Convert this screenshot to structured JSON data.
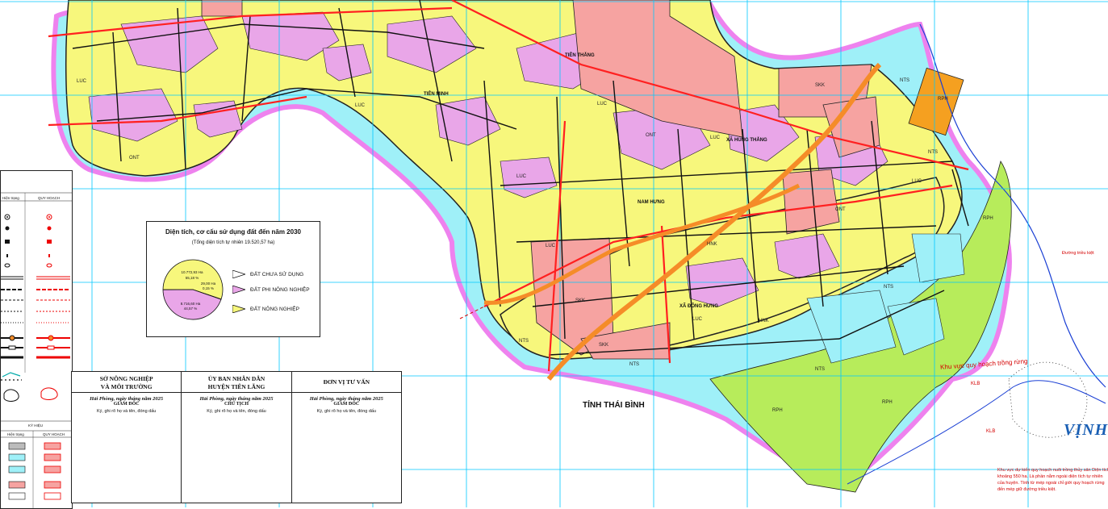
{
  "map": {
    "colors": {
      "background": "#ffffff",
      "water": "#9ff0f8",
      "agri": "#f7f77c",
      "residential": "#e9a6e8",
      "industrial": "#f6a3a1",
      "forest": "#b7ec5b",
      "boundary": "#ee82ee",
      "grid": "#00c8ff",
      "road": "#ff2020",
      "highway": "#f58c28"
    },
    "place_labels": [
      "XÃ HÙNG THẮNG",
      "XÃ ĐÔNG HƯNG",
      "TIÊN MINH",
      "TIÊN THẮNG",
      "NAM HƯNG"
    ],
    "zone_codes": [
      "LUC",
      "ONT",
      "NTS",
      "RPH",
      "KLB",
      "HNK",
      "SKK",
      "CLN",
      "DGT",
      "TSC"
    ],
    "zone_labels": {
      "luc": "LUC",
      "ont": "ONT",
      "nts": "NTS",
      "rph": "RPH",
      "klb": "KLB",
      "hnk": "HNK",
      "skk": "SKK"
    },
    "province_label": "TỈNH THÁI BÌNH",
    "bay_label": "VỊNH",
    "zone_note": "Khu vực quy hoạch trồng rừng",
    "tide_note": "Đường triều kiệt",
    "aqua_note": "Khu vực dự kiến quy hoạch nuôi trồng thủy sản Diện tích khoảng 550 ha. Là phần nằm ngoài diện tích tự nhiên của huyện. Tính từ mép ngoài chỉ giới quy hoạch rừng đến mép giữ đường triều kiệt.",
    "pie": {
      "title": "Diện tích, cơ cấu sử dụng đất đến năm 2030",
      "subtitle": "(Tổng diện tích tự nhiên 19.520,57 ha)",
      "slices": [
        {
          "name": "ĐẤT CHƯA SỬ DỤNG",
          "value_label": "29,00 Ha",
          "pct_label": "0,15 %",
          "fraction": 0.0015,
          "color": "#ffffff"
        },
        {
          "name": "ĐẤT PHI NÔNG NGHIỆP",
          "value_label": "8.716,60 Ha",
          "pct_label": "44,57 %",
          "fraction": 0.4457,
          "color": "#e9a6e8"
        },
        {
          "name": "ĐẤT NÔNG NGHIỆP",
          "value_label": "10.772,93 Ha",
          "pct_label": "55,18 %",
          "fraction": 0.5518,
          "color": "#f7f77c"
        }
      ]
    },
    "legend_panel": {
      "col1": "Hiện trạng",
      "col2": "QUY HOẠCH",
      "ky_hieu": "KÝ HIỆU",
      "hien_trang": "Hiện trạng",
      "quy_hoach": "QUY HOẠCH"
    },
    "signatures": [
      {
        "org1": "SỞ NÔNG NGHIỆP",
        "org2": "VÀ MÔI TRƯỜNG",
        "date": "Hải Phòng, ngày     tháng     năm 2025",
        "role": "GIÁM ĐỐC",
        "note": "Ký, ghi rõ họ và tên, đóng dấu"
      },
      {
        "org1": "ỦY BAN NHÂN DÂN",
        "org2": "HUYỆN TIÊN LÃNG",
        "date": "Hải Phòng, ngày     tháng     năm 2025",
        "role": "CHỦ TỊCH",
        "note": "Ký, ghi rõ họ và tên, đóng dấu"
      },
      {
        "org1": "ĐƠN VỊ TƯ VẤN",
        "org2": "",
        "date": "Hải Phòng, ngày     tháng     năm 2025",
        "role": "GIÁM ĐỐC",
        "note": "Ký, ghi rõ họ và tên, đóng dấu"
      }
    ]
  }
}
